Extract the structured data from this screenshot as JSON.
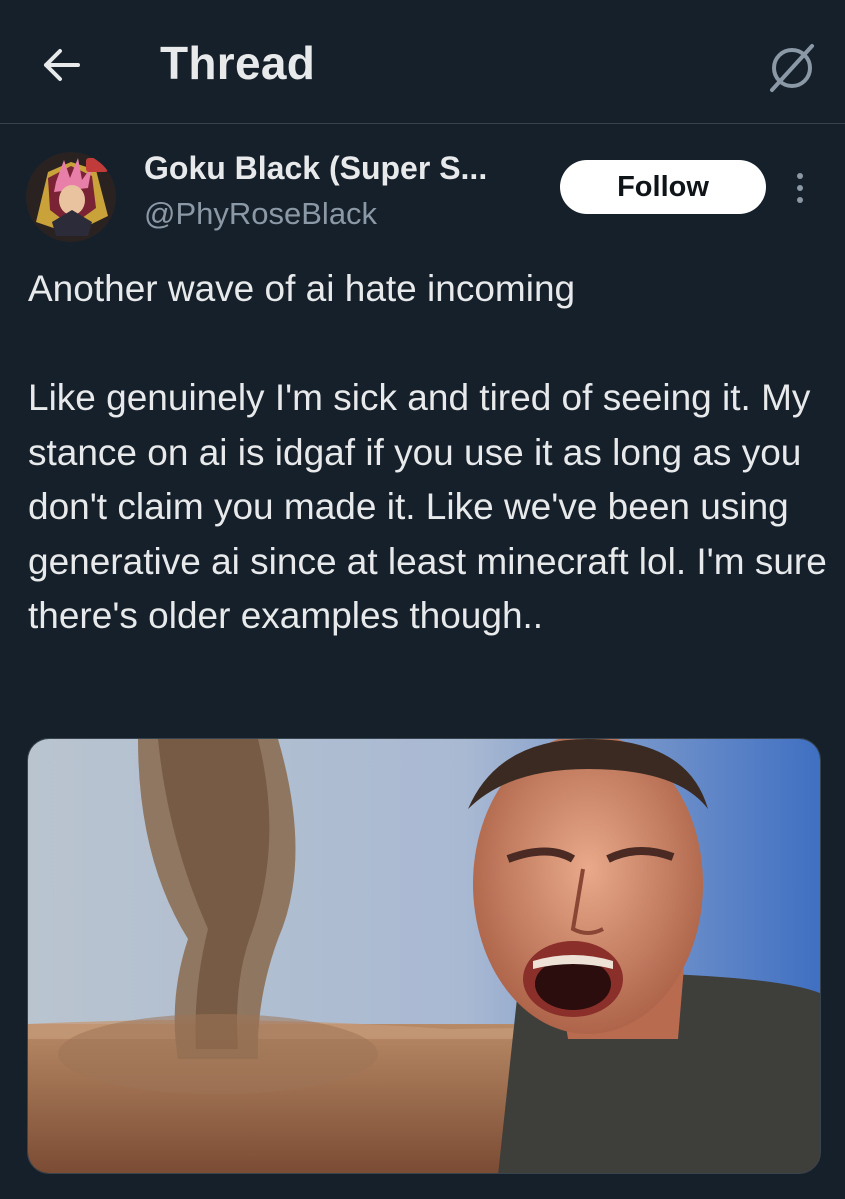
{
  "header": {
    "back_icon": "arrow-left-icon",
    "title": "Thread",
    "action_icon": "cosmic-slash-icon"
  },
  "post": {
    "author": {
      "avatar_icon": "avatar-image",
      "display_name": "Goku Black (Super S...",
      "handle": "@PhyRoseBlack"
    },
    "follow_label": "Follow",
    "more_icon": "vertical-dots-icon",
    "text_paragraphs": [
      "Another wave of ai hate incoming",
      "Like genuinely I'm sick and tired of seeing it. My stance on ai is idgaf if you use it as long as you don't claim you made it. Like we've been using generative ai since at least minecraft lol. I'm sure there's older examples though.."
    ],
    "media": {
      "icon": "photo-image"
    }
  },
  "colors": {
    "background": "#15202b",
    "text_primary": "#e7e9ea",
    "text_secondary": "#8b98a5",
    "divider": "#38444d",
    "follow_bg": "#ffffff",
    "follow_text": "#0f1419"
  }
}
